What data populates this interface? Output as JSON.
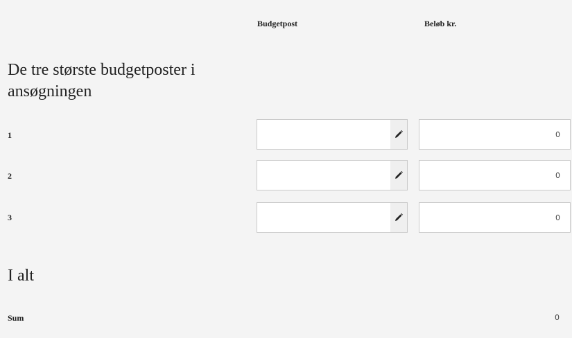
{
  "headers": {
    "budgetpost": "Budgetpost",
    "belob": "Beløb kr."
  },
  "section_title": "De tre største budgetposter i ansøgningen",
  "rows": [
    {
      "label": "1",
      "budgetpost_value": "",
      "amount": "0",
      "edit_icon": "pencil-icon"
    },
    {
      "label": "2",
      "budgetpost_value": "",
      "amount": "0",
      "edit_icon": "pencil-icon"
    },
    {
      "label": "3",
      "budgetpost_value": "",
      "amount": "0",
      "edit_icon": "pencil-icon"
    }
  ],
  "total": {
    "title": "I alt",
    "sum_label": "Sum",
    "sum_value": "0"
  }
}
